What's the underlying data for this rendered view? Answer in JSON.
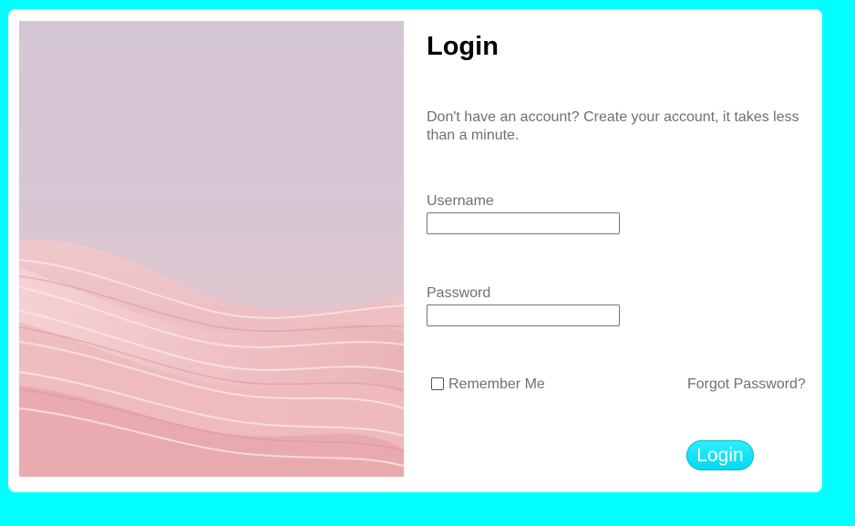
{
  "form": {
    "title": "Login",
    "subtitle": "Don't have an account? Create your account, it takes less than a minute.",
    "username_label": "Username",
    "username_value": "",
    "password_label": "Password",
    "password_value": "",
    "remember_label": "Remember Me",
    "remember_checked": false,
    "forgot_label": "Forgot Password?",
    "submit_label": "Login"
  },
  "colors": {
    "page_background": "#00ffff",
    "card_background": "#ffffff",
    "button_background": "#00e5f5",
    "muted_text": "#707070"
  },
  "hero_image": {
    "description_icon": "pink-abstract-waves-image"
  }
}
